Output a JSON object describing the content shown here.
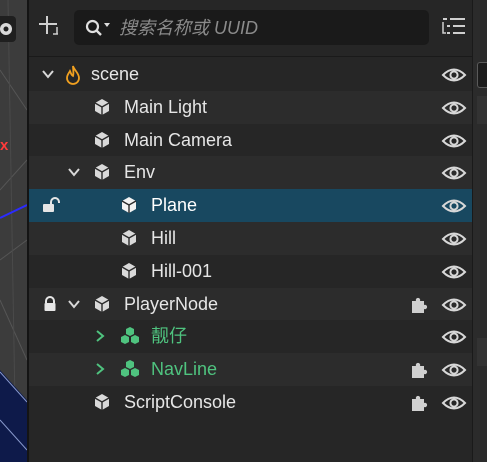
{
  "toolbar": {
    "add_icon": "plus-icon",
    "search": {
      "placeholder": "搜索名称或 UUID",
      "value": ""
    },
    "collapse_icon": "collapse-list-icon"
  },
  "viewport": {
    "axis_label": "x",
    "axis_color": "#ff3b3b"
  },
  "colors": {
    "selected_row": "#184860",
    "prefab_text": "#4fc37f",
    "panel_bg": "#262626"
  },
  "tree": {
    "nodes": [
      {
        "label": "scene",
        "icon": "scene-flame-icon",
        "expanded": true,
        "depth": 0,
        "lock": "",
        "component": false,
        "visible": true
      },
      {
        "label": "Main Light",
        "icon": "node-cube-icon",
        "depth": 1,
        "lock": "",
        "component": false,
        "visible": true
      },
      {
        "label": "Main Camera",
        "icon": "node-cube-icon",
        "depth": 1,
        "lock": "",
        "component": false,
        "visible": true
      },
      {
        "label": "Env",
        "icon": "node-cube-icon",
        "expanded": true,
        "depth": 1,
        "lock": "",
        "component": false,
        "visible": true
      },
      {
        "label": "Plane",
        "icon": "node-cube-icon",
        "depth": 2,
        "lock": "unlocked",
        "component": false,
        "visible": true,
        "selected": true
      },
      {
        "label": "Hill",
        "icon": "node-cube-icon",
        "depth": 2,
        "lock": "",
        "component": false,
        "visible": true
      },
      {
        "label": "Hill-001",
        "icon": "node-cube-icon",
        "depth": 2,
        "lock": "",
        "component": false,
        "visible": true
      },
      {
        "label": "PlayerNode",
        "icon": "node-cube-icon",
        "expanded": true,
        "depth": 1,
        "lock": "locked",
        "component": true,
        "visible": true
      },
      {
        "label": "靓仔",
        "icon": "prefab-cubes-icon",
        "expanded": false,
        "depth": 2,
        "lock": "",
        "component": false,
        "visible": true,
        "prefab": true
      },
      {
        "label": "NavLine",
        "icon": "prefab-cubes-icon",
        "expanded": false,
        "depth": 2,
        "lock": "",
        "component": true,
        "visible": true,
        "prefab": true
      },
      {
        "label": "ScriptConsole",
        "icon": "node-cube-icon",
        "depth": 1,
        "lock": "",
        "component": true,
        "visible": true
      }
    ]
  }
}
